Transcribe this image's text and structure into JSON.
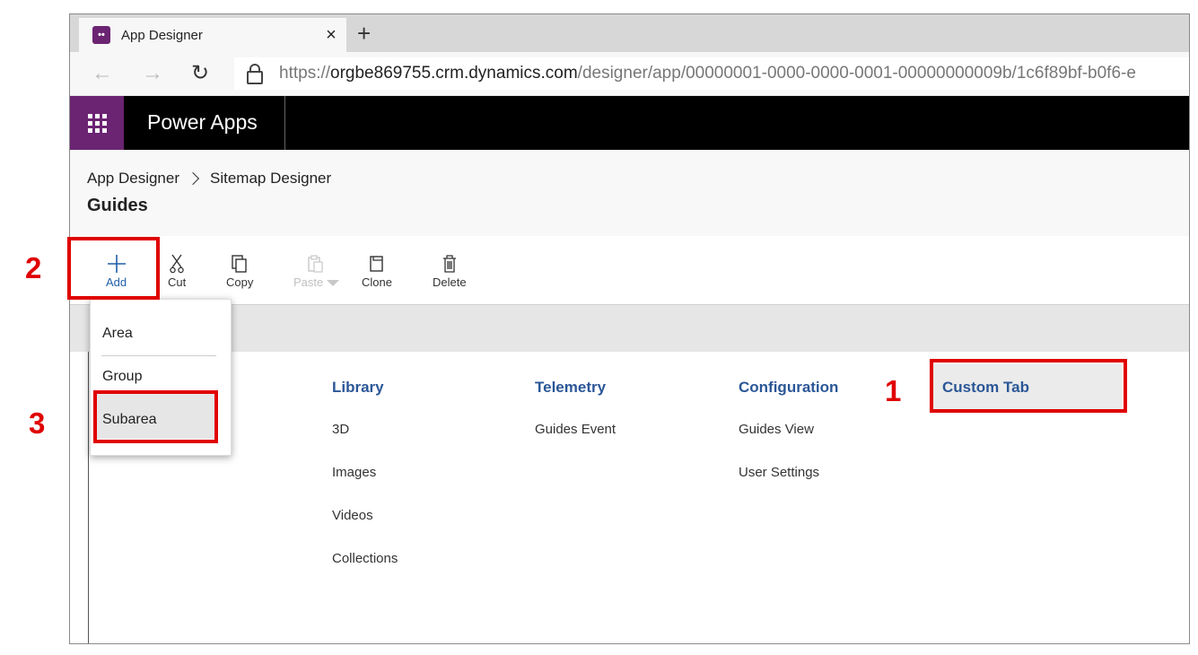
{
  "browser": {
    "tab_title": "App Designer",
    "tab_close": "×",
    "new_tab": "+",
    "url_prefix": "https://",
    "url_host": "orgbe869755.crm.dynamics.com",
    "url_path": "/designer/app/00000001-0000-0000-0001-00000000009b/1c6f89bf-b0f6-e"
  },
  "appbar": {
    "brand": "Power Apps"
  },
  "header": {
    "breadcrumb_root": "App Designer",
    "breadcrumb_current": "Sitemap Designer",
    "title": "Guides"
  },
  "toolbar": {
    "add": "Add",
    "cut": "Cut",
    "copy": "Copy",
    "paste": "Paste",
    "clone": "Clone",
    "delete": "Delete"
  },
  "add_menu": {
    "items": [
      "Area",
      "Group",
      "Subarea"
    ],
    "highlighted": "Subarea"
  },
  "sitemap": {
    "groups": [
      {
        "title": "Library",
        "items": [
          "3D",
          "Images",
          "Videos",
          "Collections"
        ]
      },
      {
        "title": "Telemetry",
        "items": [
          "Guides Event"
        ]
      },
      {
        "title": "Configuration",
        "items": [
          "Guides View",
          "User Settings"
        ]
      },
      {
        "title": "Custom Tab",
        "items": []
      }
    ]
  },
  "annotations": {
    "step1": "1",
    "step2": "2",
    "step3": "3",
    "highlight_color": "#e00000"
  },
  "colors": {
    "brand_purple": "#6b2472",
    "group_title_blue": "#2b5797",
    "accent_blue": "#1f5fa8"
  }
}
